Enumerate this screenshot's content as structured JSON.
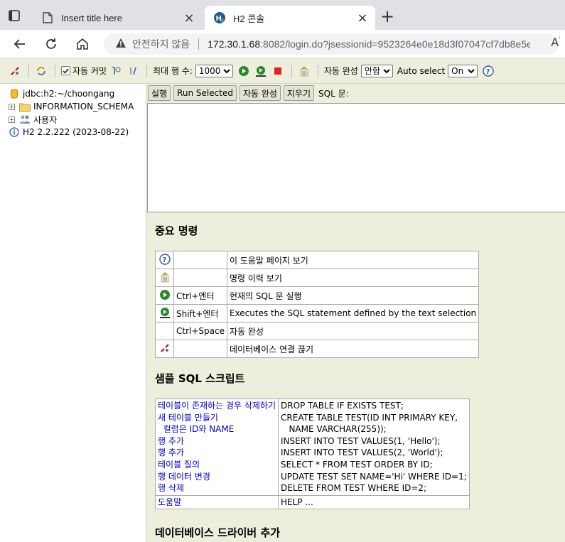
{
  "browser": {
    "tabs": [
      {
        "title": "Insert title here"
      },
      {
        "title": "H2 콘솔"
      }
    ],
    "address": {
      "security_text": "안전하지 않음",
      "host": "172.30.1.68",
      "path": ":8082/login.do?jsessionid=9523264e0e18d3f07047cf7db8e5e..."
    }
  },
  "toolbar": {
    "auto_commit_label": "자동 커밋",
    "max_rows_label": "최대 행 수:",
    "max_rows_value": "1000",
    "auto_complete_label": "자동 완성",
    "auto_complete_value": "안함",
    "auto_select_label": "Auto select",
    "auto_select_value": "On"
  },
  "tree": {
    "connection": "jdbc:h2:~/choongang",
    "items": [
      {
        "label": "INFORMATION_SCHEMA"
      },
      {
        "label": "사용자"
      }
    ],
    "version": "H2 2.2.222 (2023-08-22)"
  },
  "commands": {
    "run": "실행",
    "run_selected": "Run Selected",
    "auto_complete": "자동 완성",
    "clear": "지우기",
    "sql_label": "SQL 문:"
  },
  "help": {
    "important_title": "중요 명령",
    "important_rows": [
      {
        "key": "",
        "desc": "이 도움말 페이지 보기"
      },
      {
        "key": "",
        "desc": "명령 이력 보기"
      },
      {
        "key": "Ctrl+엔터",
        "desc": "현재의 SQL 문 실행"
      },
      {
        "key": "Shift+엔터",
        "desc": "Executes the SQL statement defined by the text selection"
      },
      {
        "key": "Ctrl+Space",
        "desc": "자동 완성"
      },
      {
        "key": "",
        "desc": "데이터베이스 연결 끊기"
      }
    ],
    "sample_title": "샘플 SQL 스크립트",
    "sample_links": [
      "테이블이 존재하는 경우 삭제하기",
      "새 테이블 만들기",
      "  컬럼은 ID와 NAME",
      "행 추가",
      "행 추가",
      "테이블 질의",
      "행 데이터 변경",
      "행 삭제"
    ],
    "sample_sql": [
      "DROP TABLE IF EXISTS TEST;",
      "CREATE TABLE TEST(ID INT PRIMARY KEY,",
      "   NAME VARCHAR(255));",
      "INSERT INTO TEST VALUES(1, 'Hello');",
      "INSERT INTO TEST VALUES(2, 'World');",
      "SELECT * FROM TEST ORDER BY ID;",
      "UPDATE TEST SET NAME='Hi' WHERE ID=1;",
      "DELETE FROM TEST WHERE ID=2;"
    ],
    "help_link": "도움말",
    "help_sql": "HELP ...",
    "driver_title": "데이터베이스 드라이버 추가"
  }
}
